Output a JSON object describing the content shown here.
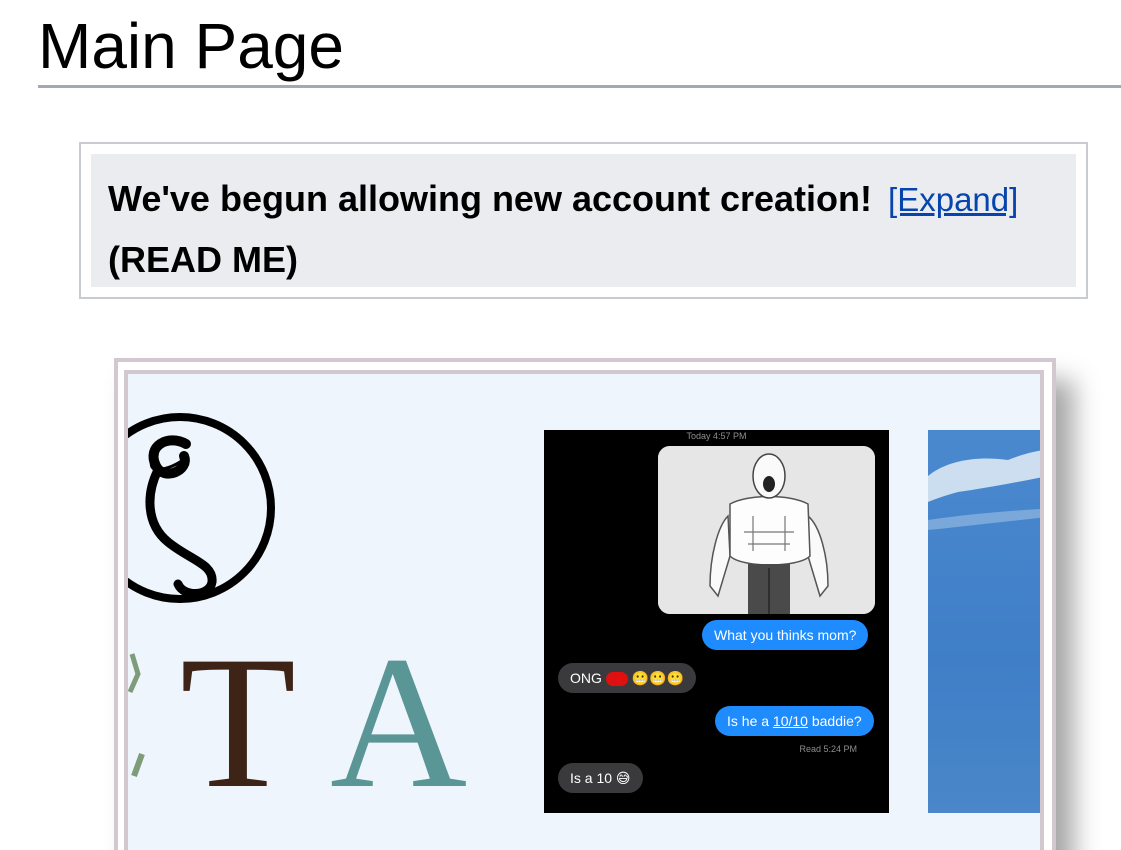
{
  "page": {
    "title": "Main Page"
  },
  "notice": {
    "text_line1": "We've begun allowing new account creation!",
    "expand_link": "[Expand]",
    "text_line2": "(READ ME)"
  },
  "gallery": {
    "logo": {
      "letters": [
        "T",
        "A"
      ],
      "colors": {
        "T": "#3d2416",
        "A": "#5b9696",
        "ring": "#000000"
      }
    },
    "chat": {
      "timestamp": "Today 4:57 PM",
      "messages": [
        {
          "from": "me",
          "text": "What you thinks mom?"
        },
        {
          "from": "them",
          "text_prefix": "ONG",
          "emoji": "😬😬😬"
        },
        {
          "from": "me",
          "text_before": "Is he a ",
          "text_underlined": "10/10",
          "text_after": " baddie?"
        },
        {
          "from": "them",
          "text": "Is a 10 😅"
        }
      ],
      "read_receipt": "Read 5:24 PM"
    },
    "sky_image": {
      "colors": {
        "sky": "#4384cb",
        "cloud": "#dfe9f4"
      }
    }
  },
  "colors": {
    "link": "#0645ad",
    "notice_bg": "#eaecf0",
    "frame_border": "#d4c8d0",
    "gallery_bg": "#eef5fc",
    "bubble_out": "#1e8bff",
    "bubble_in": "#3a3a3c"
  }
}
